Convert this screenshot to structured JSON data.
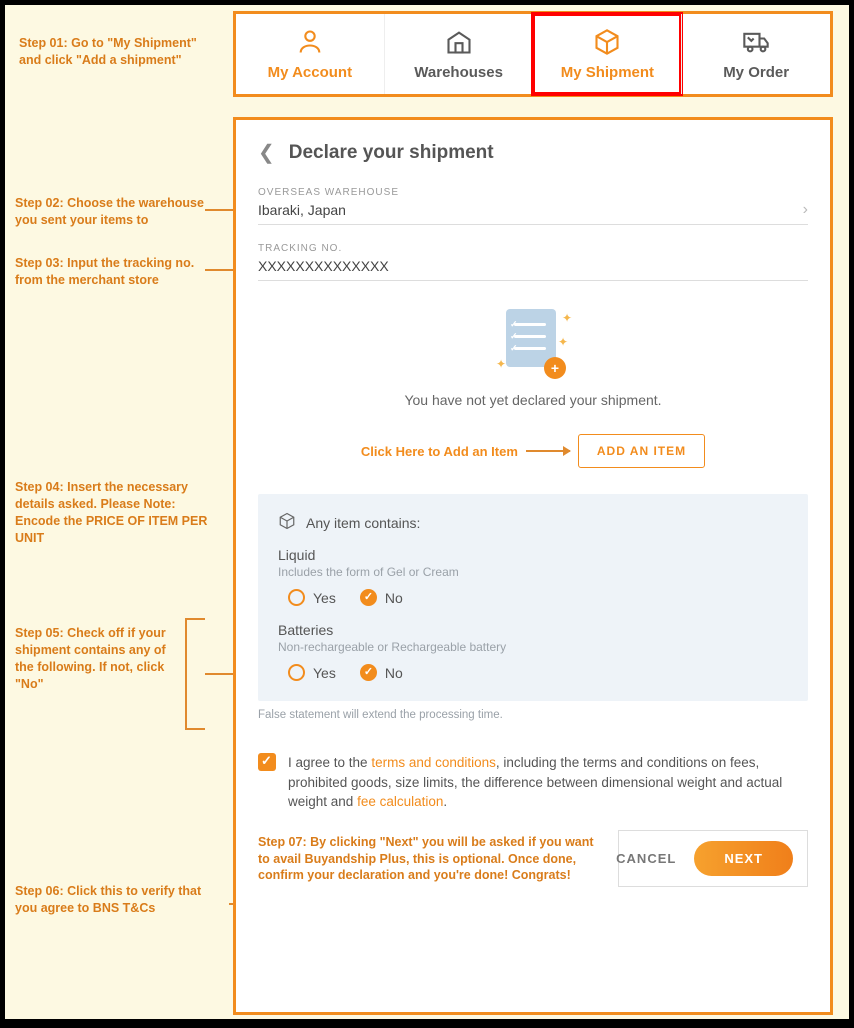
{
  "steps": {
    "s1": "Step 01: Go to \"My Shipment\" and click \"Add a shipment\"",
    "s2": "Step 02: Choose the warehouse you sent your items to",
    "s3": "Step 03: Input the tracking no. from the merchant store",
    "s4": "Step 04: Insert the necessary details asked. Please Note: Encode the PRICE OF ITEM PER UNIT",
    "s5": "Step 05: Check off if your shipment contains any of the following. If not, click \"No\"",
    "s6": "Step 06: Click this to verify that you agree to BNS T&Cs",
    "s7": "Step 07: By clicking \"Next\" you will be asked if you want to avail Buyandship Plus, this is optional. Once done, confirm your declaration and you're done! Congrats!",
    "addhint": "Click Here to Add an Item"
  },
  "nav": {
    "account": "My Account",
    "warehouses": "Warehouses",
    "shipment": "My Shipment",
    "order": "My Order"
  },
  "panel": {
    "title": "Declare your shipment",
    "warehouse_label": "OVERSEAS WAREHOUSE",
    "warehouse_value": "Ibaraki, Japan",
    "tracking_label": "TRACKING NO.",
    "tracking_value": "XXXXXXXXXXXXXX",
    "notyet": "You have not yet declared your shipment.",
    "additem": "ADD AN ITEM",
    "contains_header": "Any item contains:",
    "liquid_label": "Liquid",
    "liquid_sub": "Includes the form of Gel or Cream",
    "batteries_label": "Batteries",
    "batteries_sub": "Non-rechargeable or Rechargeable battery",
    "yes": "Yes",
    "no": "No",
    "false_note": "False statement will extend the processing time.",
    "agree_pre": "I agree to the ",
    "agree_tc": "terms and conditions",
    "agree_mid": ", including the terms and conditions on fees, prohibited goods, size limits, the difference between dimensional weight and actual weight and ",
    "agree_fee": "fee calculation",
    "agree_post": ".",
    "cancel": "CANCEL",
    "next": "NEXT"
  }
}
